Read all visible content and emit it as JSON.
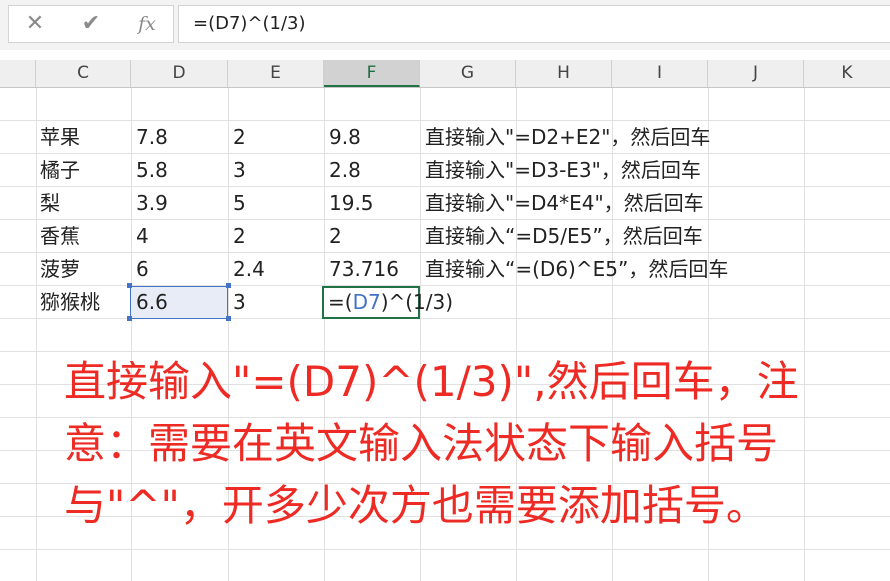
{
  "formula_bar": {
    "cancel": "✕",
    "enter": "✔",
    "fx": "fx",
    "formula": "=(D7)^(1/3)"
  },
  "columns": [
    "C",
    "D",
    "E",
    "F",
    "G",
    "H",
    "I",
    "J",
    "K"
  ],
  "selected_column": "F",
  "rows": [
    {
      "c": "苹果",
      "d": "7.8",
      "e": "2",
      "f": "9.8",
      "g": "直接输入\"=D2+E2\"，然后回车"
    },
    {
      "c": "橘子",
      "d": "5.8",
      "e": "3",
      "f": "2.8",
      "g": "直接输入\"=D3-E3\"，然后回车"
    },
    {
      "c": "梨",
      "d": "3.9",
      "e": "5",
      "f": "19.5",
      "g": "直接输入\"=D4*E4\"，然后回车"
    },
    {
      "c": "香蕉",
      "d": "4",
      "e": "2",
      "f": "2",
      "g": "直接输入“=D5/E5”，然后回车"
    },
    {
      "c": "菠萝",
      "d": "6",
      "e": "2.4",
      "f": "73.716",
      "g": "直接输入“=(D6)^E5”，然后回车"
    },
    {
      "c": "猕猴桃",
      "d": "6.6",
      "e": "3",
      "f": "",
      "g": ""
    }
  ],
  "editing_cell": {
    "prefix": "=(",
    "ref": "D7",
    "suffix": ")^(1/3)"
  },
  "annotation": {
    "line1": "直接输入\"=(D7)^(1/3)\",然后回车，注",
    "line2": "意：需要在英文输入法状态下输入括号",
    "line3": "与\"^\"，开多少次方也需要添加括号。"
  },
  "colors": {
    "annotation": "#ee2a24",
    "reference": "#4472c4",
    "active_cell": "#217346"
  }
}
